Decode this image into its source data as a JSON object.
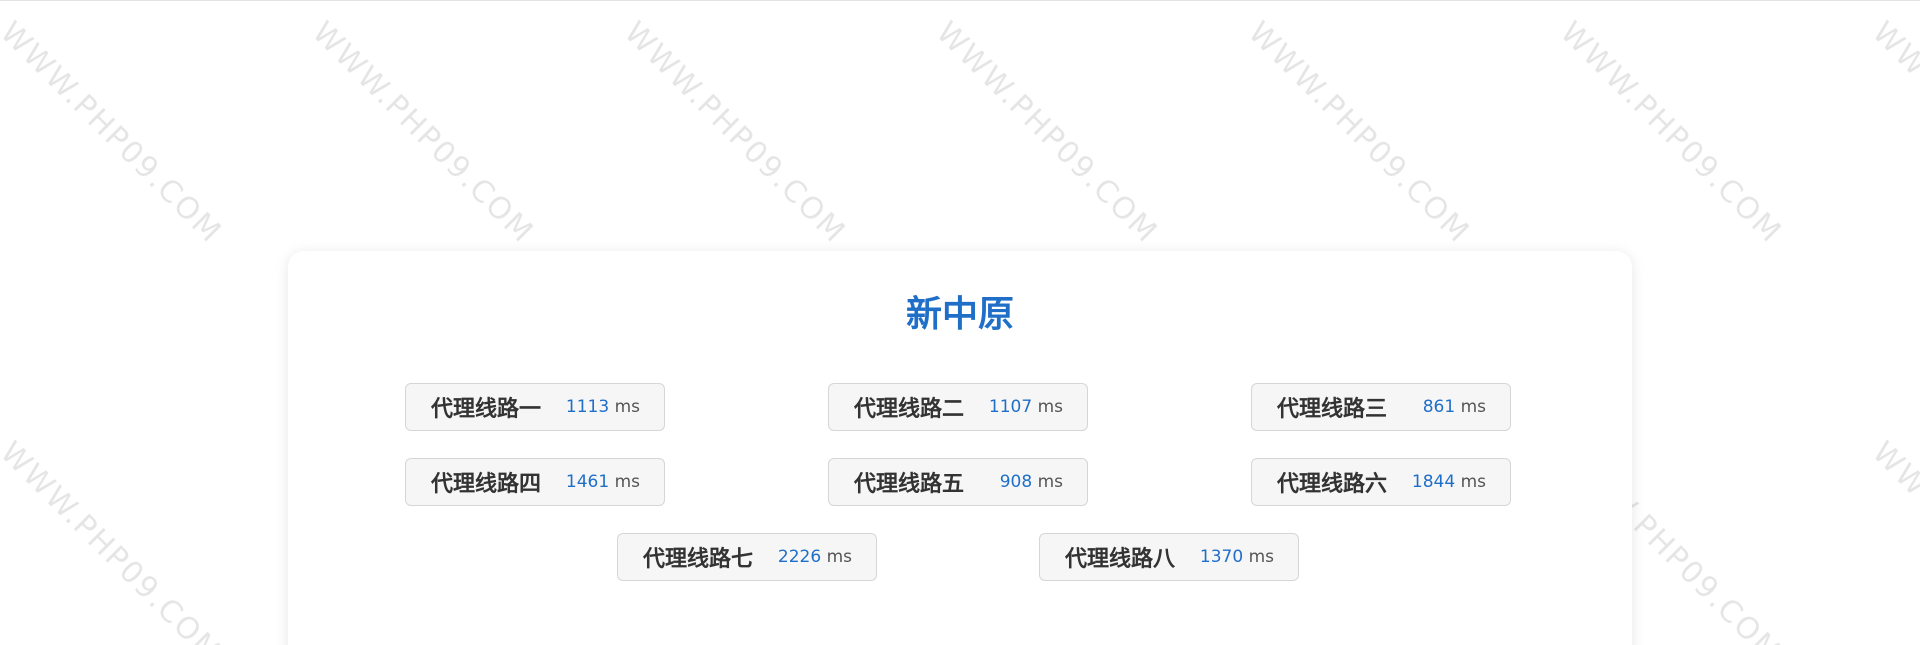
{
  "watermark": {
    "text": "WWW.PHP09.COM"
  },
  "card": {
    "title": "新中原"
  },
  "lines": [
    {
      "name": "代理线路一",
      "latency": "1113",
      "unit": "ms"
    },
    {
      "name": "代理线路二",
      "latency": "1107",
      "unit": "ms"
    },
    {
      "name": "代理线路三",
      "latency": "861",
      "unit": "ms"
    },
    {
      "name": "代理线路四",
      "latency": "1461",
      "unit": "ms"
    },
    {
      "name": "代理线路五",
      "latency": "908",
      "unit": "ms"
    },
    {
      "name": "代理线路六",
      "latency": "1844",
      "unit": "ms"
    },
    {
      "name": "代理线路七",
      "latency": "2226",
      "unit": "ms"
    },
    {
      "name": "代理线路八",
      "latency": "1370",
      "unit": "ms"
    }
  ],
  "colors": {
    "accent": "#1f6fc9",
    "button_bg": "#f6f6f6",
    "button_border": "#d6d6d6",
    "text_dark": "#333333"
  }
}
